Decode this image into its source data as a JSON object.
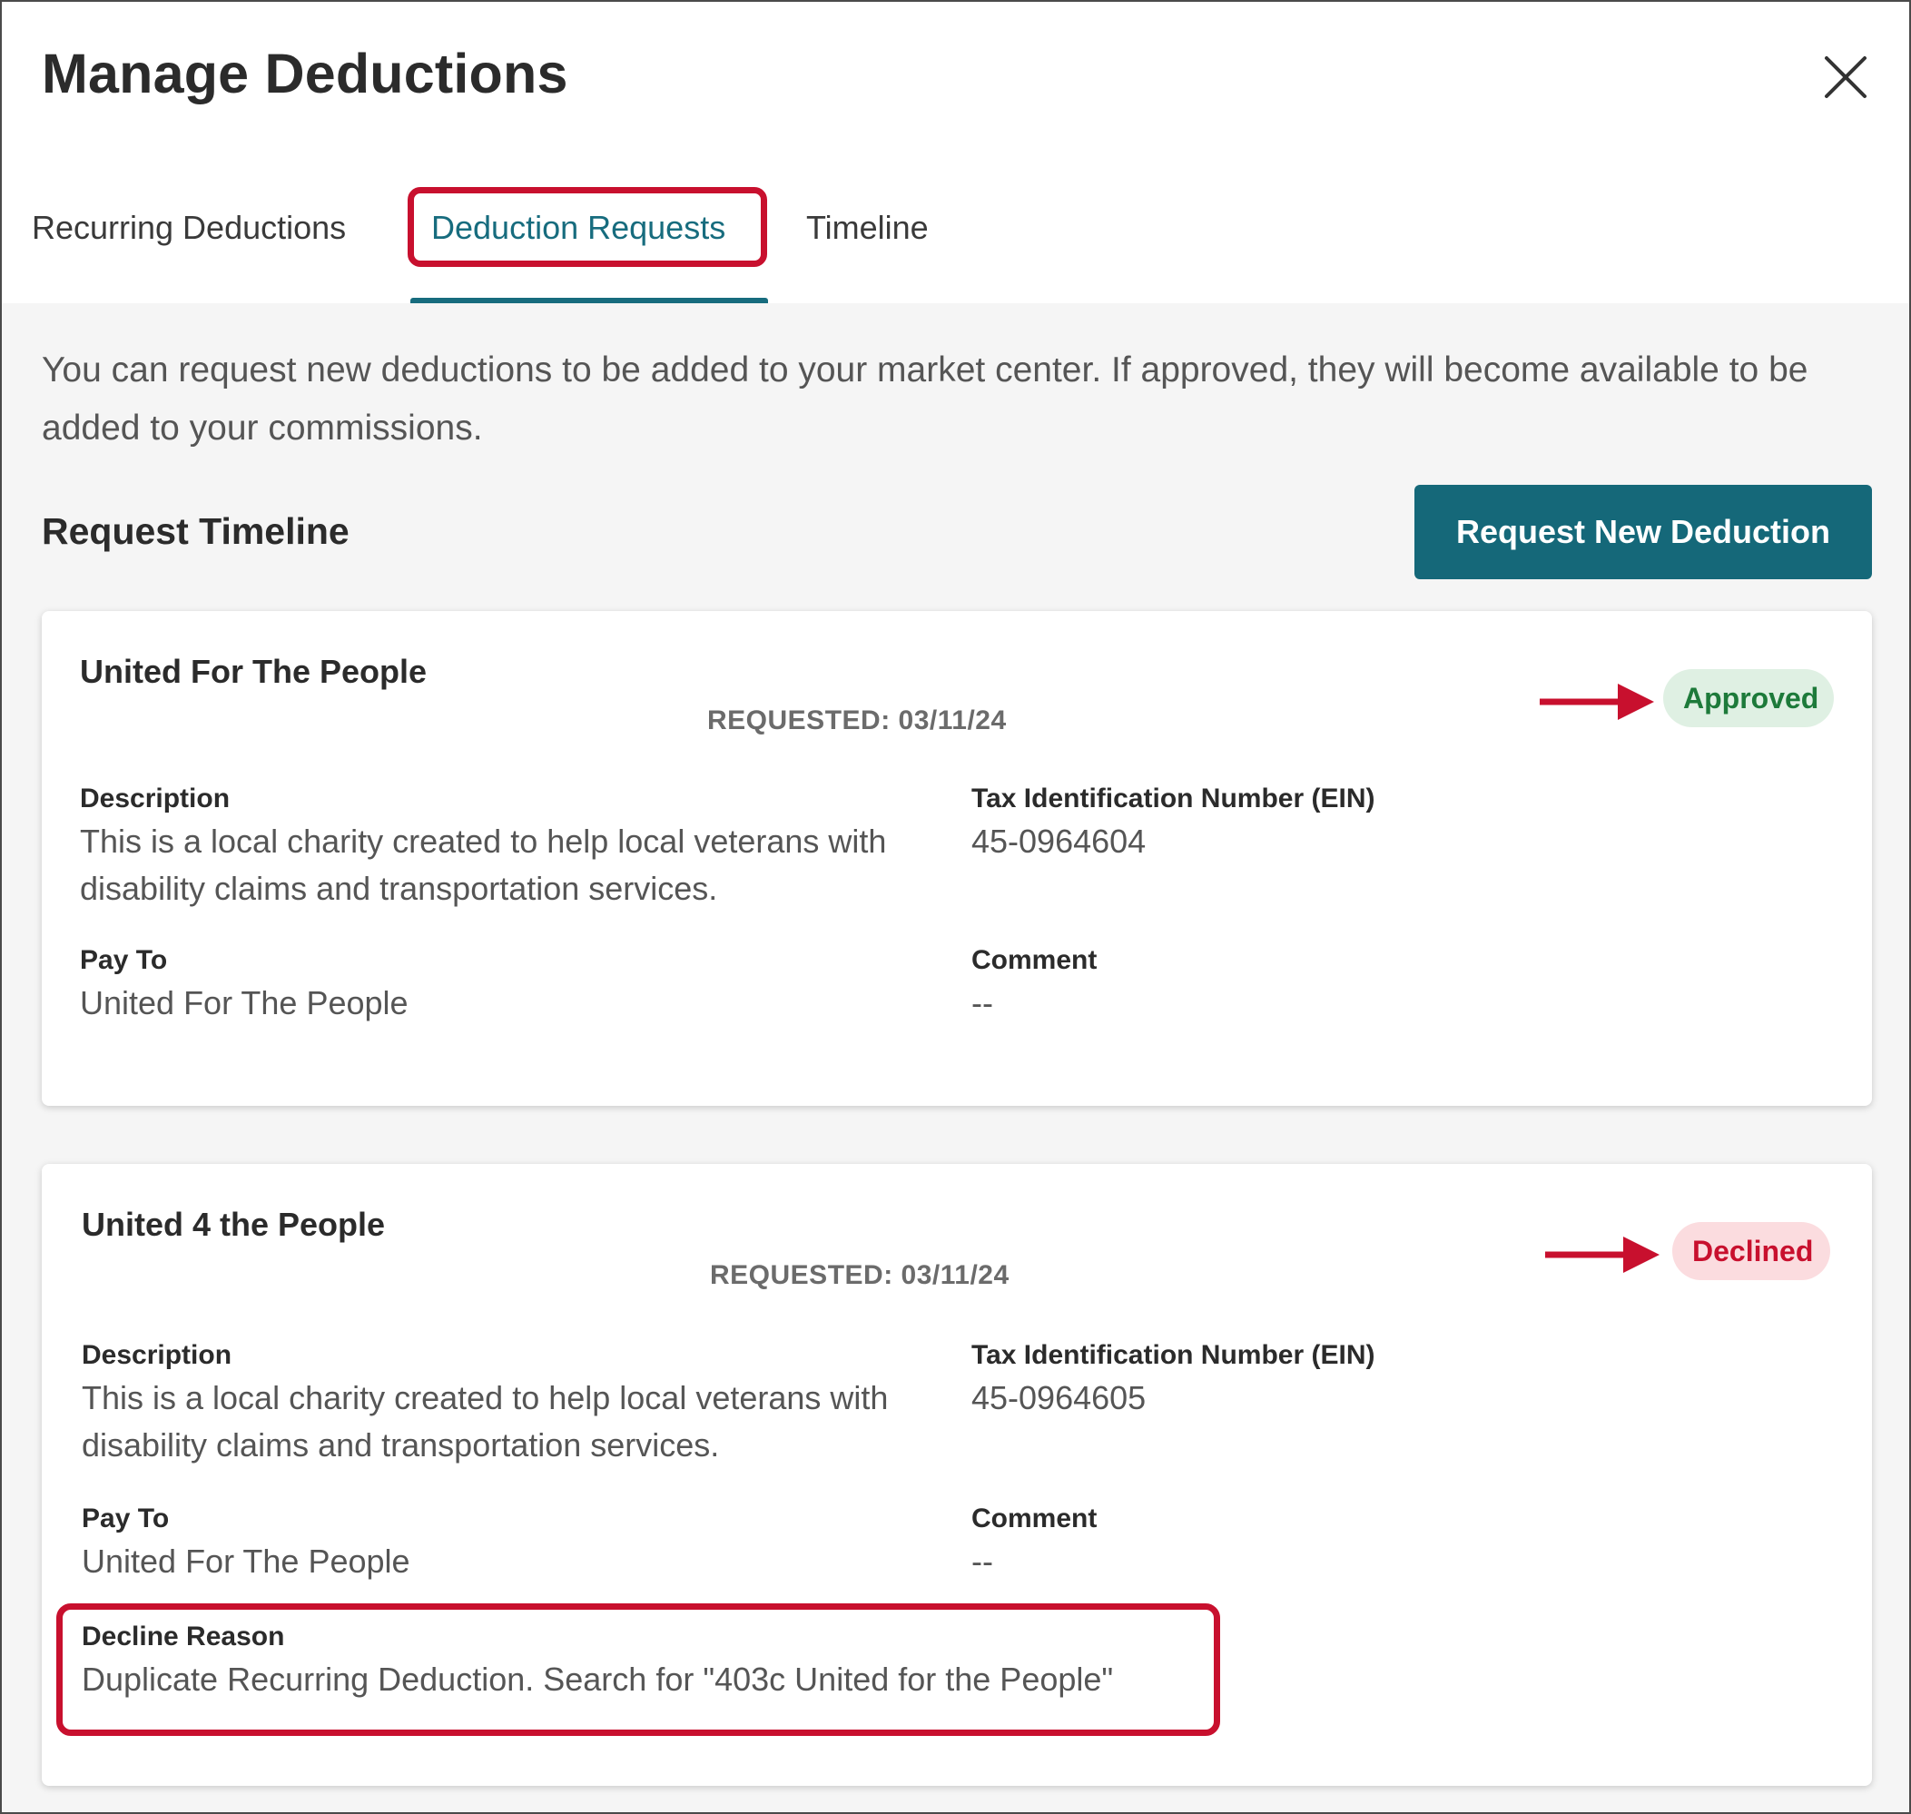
{
  "header": {
    "title": "Manage Deductions"
  },
  "tabs": [
    {
      "label": "Recurring Deductions",
      "active": false
    },
    {
      "label": "Deduction Requests",
      "active": true
    },
    {
      "label": "Timeline",
      "active": false
    }
  ],
  "intro_text": "You can request new deductions to be added to your market center. If approved, they will become available to be added to your commissions.",
  "section": {
    "title": "Request Timeline",
    "button_label": "Request New Deduction"
  },
  "requests": [
    {
      "name": "United For The People",
      "requested": "REQUESTED: 03/11/24",
      "status": "Approved",
      "labels": {
        "description": "Description",
        "ein": "Tax Identification Number (EIN)",
        "pay_to": "Pay To",
        "comment": "Comment"
      },
      "description": "This is a local charity created to help local veterans with disability claims and transportation services.",
      "ein": "45-0964604",
      "pay_to": "United For The People",
      "comment": "--"
    },
    {
      "name": "United 4 the People",
      "requested": "REQUESTED: 03/11/24",
      "status": "Declined",
      "labels": {
        "description": "Description",
        "ein": "Tax Identification Number (EIN)",
        "pay_to": "Pay To",
        "comment": "Comment",
        "decline_reason": "Decline Reason"
      },
      "description": "This is a local charity created to help local veterans with disability claims and transportation services.",
      "ein": "45-0964605",
      "pay_to": "United For The People",
      "comment": "--",
      "decline_reason": "Duplicate Recurring Deduction. Search for \"403c United for the People\""
    }
  ],
  "colors": {
    "accent": "#176c7e",
    "button": "#156879",
    "highlight": "#c8102e",
    "approved_bg": "#dff0e3",
    "approved_text": "#1d7a3a",
    "declined_bg": "#fbdcdf",
    "declined_text": "#c8102e"
  },
  "icons": {
    "close": "close-icon",
    "annotation_arrow": "arrow-right-icon"
  }
}
